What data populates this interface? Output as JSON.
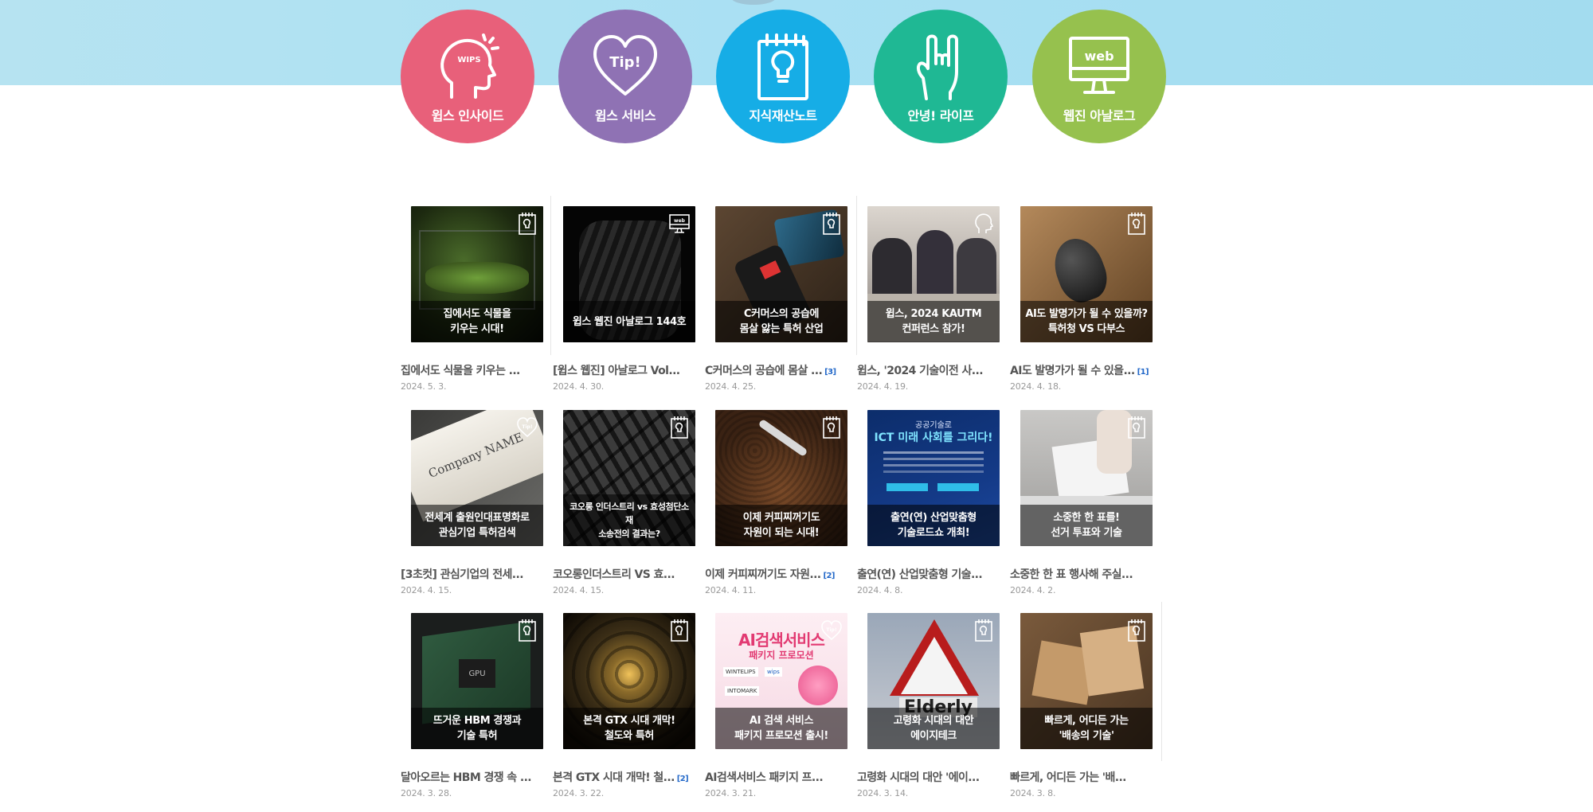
{
  "categories": [
    {
      "label": "윕스 인사이드",
      "color": "#e8607a",
      "icon": "head-idea-icon"
    },
    {
      "label": "윕스 서비스",
      "color": "#8f72b4",
      "icon": "heart-tip-icon"
    },
    {
      "label": "지식재산노트",
      "color": "#16ade6",
      "icon": "notepad-bulb-icon"
    },
    {
      "label": "안녕! 라이프",
      "color": "#1fb894",
      "icon": "rock-hand-icon"
    },
    {
      "label": "웹진 아날로그",
      "color": "#96c14e",
      "icon": "web-monitor-icon"
    }
  ],
  "icon_texts": {
    "heart": "Tip!",
    "web": "web",
    "head": "WIPS"
  },
  "posts": [
    {
      "caption": "집에서도 식물을\n키우는 시대!",
      "title": "집에서도 식물을 키우는 ...",
      "date": "2024. 5. 3.",
      "comments": "",
      "badge": "notepad-bulb-icon",
      "theme": "terrarium"
    },
    {
      "caption": "윕스 웹진 아날로그 144호",
      "title": "[윕스 웹진] 아날로그 Vol...",
      "date": "2024. 4. 30.",
      "comments": "",
      "badge": "web-monitor-icon",
      "theme": "tire"
    },
    {
      "caption": "C커머스의 공습에\n몸살 앓는 특허 산업",
      "title": "C커머스의 공습에 몸살 ...",
      "date": "2024. 4. 25.",
      "comments": "[3]",
      "badge": "notepad-bulb-icon",
      "theme": "phone"
    },
    {
      "caption": "윕스, 2024 KAUTM\n컨퍼런스 참가!",
      "title": "윕스, '2024 기술이전 사...",
      "date": "2024. 4. 19.",
      "comments": "",
      "badge": "head-idea-icon",
      "theme": "meeting"
    },
    {
      "caption": "AI도 발명가가 될 수 있을까?\n특허청 VS 다부스",
      "title": "AI도 발명가가 될 수 있을...",
      "date": "2024. 4. 18.",
      "comments": "[1]",
      "badge": "notepad-bulb-icon",
      "theme": "lamp"
    },
    {
      "caption": "전세계 출원인대표명화로\n관심기업 특허검색",
      "title": "[3초컷] 관심기업의 전세...",
      "date": "2024. 4. 15.",
      "comments": "",
      "badge": "heart-tip-icon",
      "theme": "nameplate",
      "plate_text": "Company NAME"
    },
    {
      "caption": "코오롱 인더스트리 vs 효성첨단소재\n소송전의 결과는?",
      "title": "코오롱인더스트리 VS 효...",
      "date": "2024. 4. 15.",
      "comments": "",
      "badge": "notepad-bulb-icon",
      "theme": "tread",
      "small": true
    },
    {
      "caption": "이제 커피찌꺼기도\n자원이 되는 시대!",
      "title": "이제 커피찌꺼기도 자원...",
      "date": "2024. 4. 11.",
      "comments": "[2]",
      "badge": "notepad-bulb-icon",
      "theme": "coffee"
    },
    {
      "caption": "출연(연) 산업맞춤형\n기술로드쇼 개최!",
      "title": "출연(연) 산업맞춤형 기술...",
      "date": "2024. 4. 8.",
      "comments": "",
      "badge": "",
      "theme": "poster",
      "poster_top": "공공기술로",
      "poster_head": "ICT 미래 사회를 그리다!"
    },
    {
      "caption": "소중한 한 표를!\n선거 투표와 기술",
      "title": "소중한 한 표 행사해 주실...",
      "date": "2024. 4. 2.",
      "comments": "",
      "badge": "notepad-bulb-icon",
      "theme": "ballot"
    },
    {
      "caption": "뜨거운 HBM 경쟁과\n기술 특허",
      "title": "달아오르는 HBM 경쟁 속 ...",
      "date": "2024. 3. 28.",
      "comments": "",
      "badge": "notepad-bulb-icon",
      "theme": "gpu",
      "chip_text": "GPU"
    },
    {
      "caption": "본격 GTX 시대 개막!\n철도와 특허",
      "title": "본격 GTX 시대 개막! 철...",
      "date": "2024. 3. 22.",
      "comments": "[2]",
      "badge": "notepad-bulb-icon",
      "theme": "tunnel"
    },
    {
      "caption": "AI 검색 서비스\n패키지 프로모션 출시!",
      "title": "AI검색서비스 패키지 프...",
      "date": "2024. 3. 21.",
      "comments": "",
      "badge": "heart-tip-icon",
      "theme": "promo",
      "promo_head": "AI검색서비스",
      "promo_sub": "패키지 프로모션",
      "brand_a": "WINTELIPS",
      "brand_b": "wips",
      "brand_c": "INTOMARK"
    },
    {
      "caption": "고령화 시대의 대안\n에이지테크",
      "title": "고령화 시대의 대안 '에이...",
      "date": "2024. 3. 14.",
      "comments": "",
      "badge": "notepad-bulb-icon",
      "theme": "elderly",
      "sign_text": "Elderly"
    },
    {
      "caption": "빠르게, 어디든 가는\n'배송의 기술'",
      "title": "빠르게, 어디든 가는 '배...",
      "date": "2024. 3. 8.",
      "comments": "",
      "badge": "notepad-bulb-icon",
      "theme": "boxes"
    }
  ]
}
